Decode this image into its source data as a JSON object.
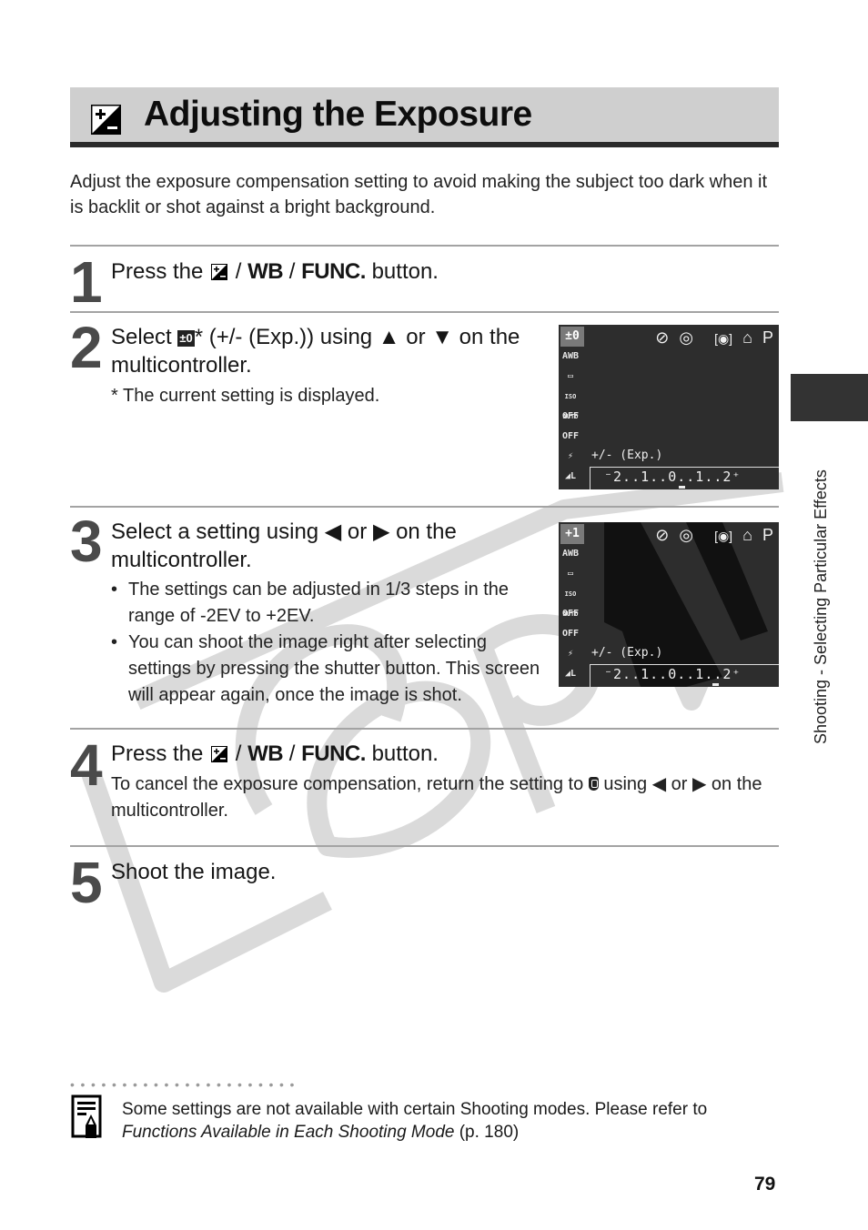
{
  "page": {
    "title": "Adjusting the Exposure",
    "intro": "Adjust the exposure compensation setting to avoid making the subject too dark when it is backlit or shot against a bright background.",
    "side_tab_label": "Shooting - Selecting Particular Effects",
    "page_number": "79",
    "watermark_text": "COPY"
  },
  "steps": [
    {
      "number": "1",
      "head_prefix": "Press the",
      "head_wb": "WB",
      "head_func": "FUNC.",
      "head_suffix": "button.",
      "separator": "/"
    },
    {
      "number": "2",
      "head_prefix": "Select",
      "head_rest": "* (+/-  (Exp.)) using ▲ or ▼ on the multicontroller.",
      "footnote": "* The current setting is displayed."
    },
    {
      "number": "3",
      "head": "Select a setting using ◀ or ▶ on the multicontroller.",
      "bullets": [
        "The settings can be adjusted in 1/3 steps in the range of -2EV to +2EV.",
        "You can shoot the image right after selecting settings by pressing the shutter button.  This screen will appear again, once the image is shot."
      ]
    },
    {
      "number": "4",
      "head_prefix": "Press the",
      "head_wb": "WB",
      "head_func": "FUNC.",
      "head_suffix": "button.",
      "separator": "/",
      "body_prefix": "To cancel the exposure compensation, return the setting to",
      "body_suffix": "using ◀ or ▶ on the multicontroller."
    },
    {
      "number": "5",
      "head": "Shoot the image."
    }
  ],
  "lcd_screens": [
    {
      "selected_value": "±0",
      "menu_items": [
        "AWB",
        "▭",
        "ISO AUTO",
        "OFF",
        "OFF",
        "⚡",
        "◢L"
      ],
      "top_icons": [
        "flash-off",
        "red-eye",
        "metering",
        "self-timer",
        "P"
      ],
      "top_glyphs": [
        "⊘",
        "◎",
        "[◉]",
        "⌂",
        "P"
      ],
      "label": "+/- (Exp.)",
      "scale": "⁻2..1..0..1..2⁺",
      "current_ev": 0
    },
    {
      "selected_value": "+1",
      "menu_items": [
        "AWB",
        "▭",
        "ISO AUTO",
        "OFF",
        "OFF",
        "⚡",
        "◢L"
      ],
      "top_icons": [
        "flash-off",
        "red-eye",
        "metering",
        "self-timer",
        "P"
      ],
      "top_glyphs": [
        "⊘",
        "◎",
        "[◉]",
        "⌂",
        "P"
      ],
      "label": "+/- (Exp.)",
      "scale": "⁻2..1..0..1..2⁺",
      "current_ev": 1
    }
  ],
  "note": {
    "text": "Some settings are not available with certain Shooting modes. Please refer to",
    "link_italic": "Functions Available in Each Shooting Mode",
    "page_ref": "(p. 180)"
  },
  "dots_line": "••••••••••••••••••••••"
}
